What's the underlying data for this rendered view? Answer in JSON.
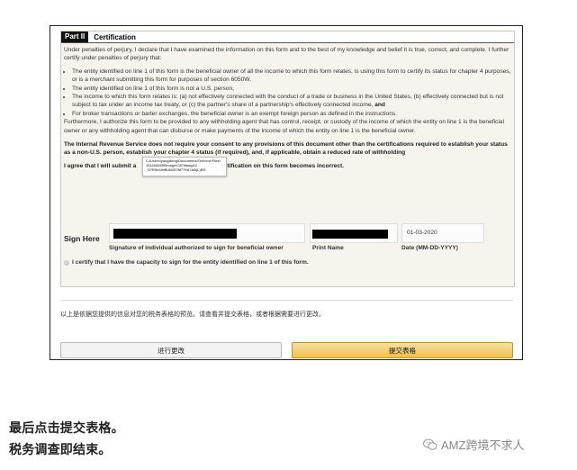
{
  "form": {
    "part_label": "Part II",
    "part_title": "Certification",
    "intro": "Under penalties of perjury, I declare that I have examined the information on this form and to the best of my knowledge and belief it is true, correct, and complete. I further certify under penalties of perjury that:",
    "bullets": [
      "The entity identified on line 1 of this form is the beneficial owner of all the income to which this form relates, is using this form to certify its status for chapter 4 purposes, or is a merchant submitting this form for purposes of section 6050W,",
      "The entity identified on line 1 of this form is not a U.S. person,",
      "The income to which this form relates is: (a) not effectively connected with the conduct of a trade or business in the United States, (b) effectively connected but is not subject to tax under an income tax treaty, or (c) the partner's share of a partnership's effectively connected income,",
      "For broker transactions or barter exchanges, the beneficial owner is an exempt foreign person as defined in the instructions."
    ],
    "bullet3_and": "and",
    "furthermore": "Furthermore, I authorize this form to be provided to any withholding agent that has control, receipt, or custody of the income of which the entity on line 1 is the beneficial owner or any withholding agent that can disburse or make payments of the income of which the entity on line 1 is the beneficial owner.",
    "irs_notice": "The Internal Revenue Service does not require your consent to any provisions of this document other than the certifications required to establish your status as a non-U.S. person, establish your chapter 4 status (if required), and, if applicable, obtain a reduced rate of withholding",
    "agree_start": "I agree that I will submit a",
    "agree_end": "any certification on this form becomes incorrect.",
    "tooltip_lines": [
      "C:\\Users\\yongdong\\Documents\\Tencent Files\\",
      "1012449435\\Image\\C2C\\Image1\\",
      "_D7RXKNHBUN3G7M7T9A7AB(L)RG"
    ],
    "sign_here": "Sign Here",
    "signature_label": "Signature of individual authorized to sign for beneficial owner",
    "print_name_label": "Print Name",
    "date_value": "01-03-2020",
    "date_label": "Date (MM-DD-YYYY)",
    "capacity_text": "I certify that I have the capacity to sign for the entity identified on line 1 of this form."
  },
  "notice": "以上是依据您提供的信息对您的税务表格的预览。请查看并提交表格，或者根据需要进行更改。",
  "buttons": {
    "edit": "进行更改",
    "submit": "提交表格"
  },
  "captions": {
    "line1": "最后点击提交表格。",
    "line2": "税务调查即结束。"
  },
  "watermark": {
    "text": "AMZ跨境不求人",
    "icon": "wechat-icon"
  },
  "colors": {
    "submit_button": "#f0c14b",
    "form_background": "#f6f4ed"
  }
}
